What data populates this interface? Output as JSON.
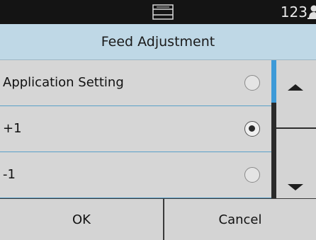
{
  "status_bar": {
    "scanner_icon": "scanner-icon",
    "count": "123",
    "user_icon": "user-icon"
  },
  "dialog": {
    "title": "Feed Adjustment"
  },
  "options": [
    {
      "label": "Application Setting",
      "selected": false
    },
    {
      "label": "+1",
      "selected": true
    },
    {
      "label": "-1",
      "selected": false
    }
  ],
  "scroll": {
    "up_icon": "triangle-up-icon",
    "down_icon": "triangle-down-icon"
  },
  "buttons": {
    "ok": "OK",
    "cancel": "Cancel"
  },
  "colors": {
    "status_bar_bg": "#141414",
    "title_bar_bg": "#bfd8e6",
    "list_bg": "#d6d6d6",
    "divider": "#5aa0c8",
    "scroll_thumb": "#3d9ad8"
  }
}
